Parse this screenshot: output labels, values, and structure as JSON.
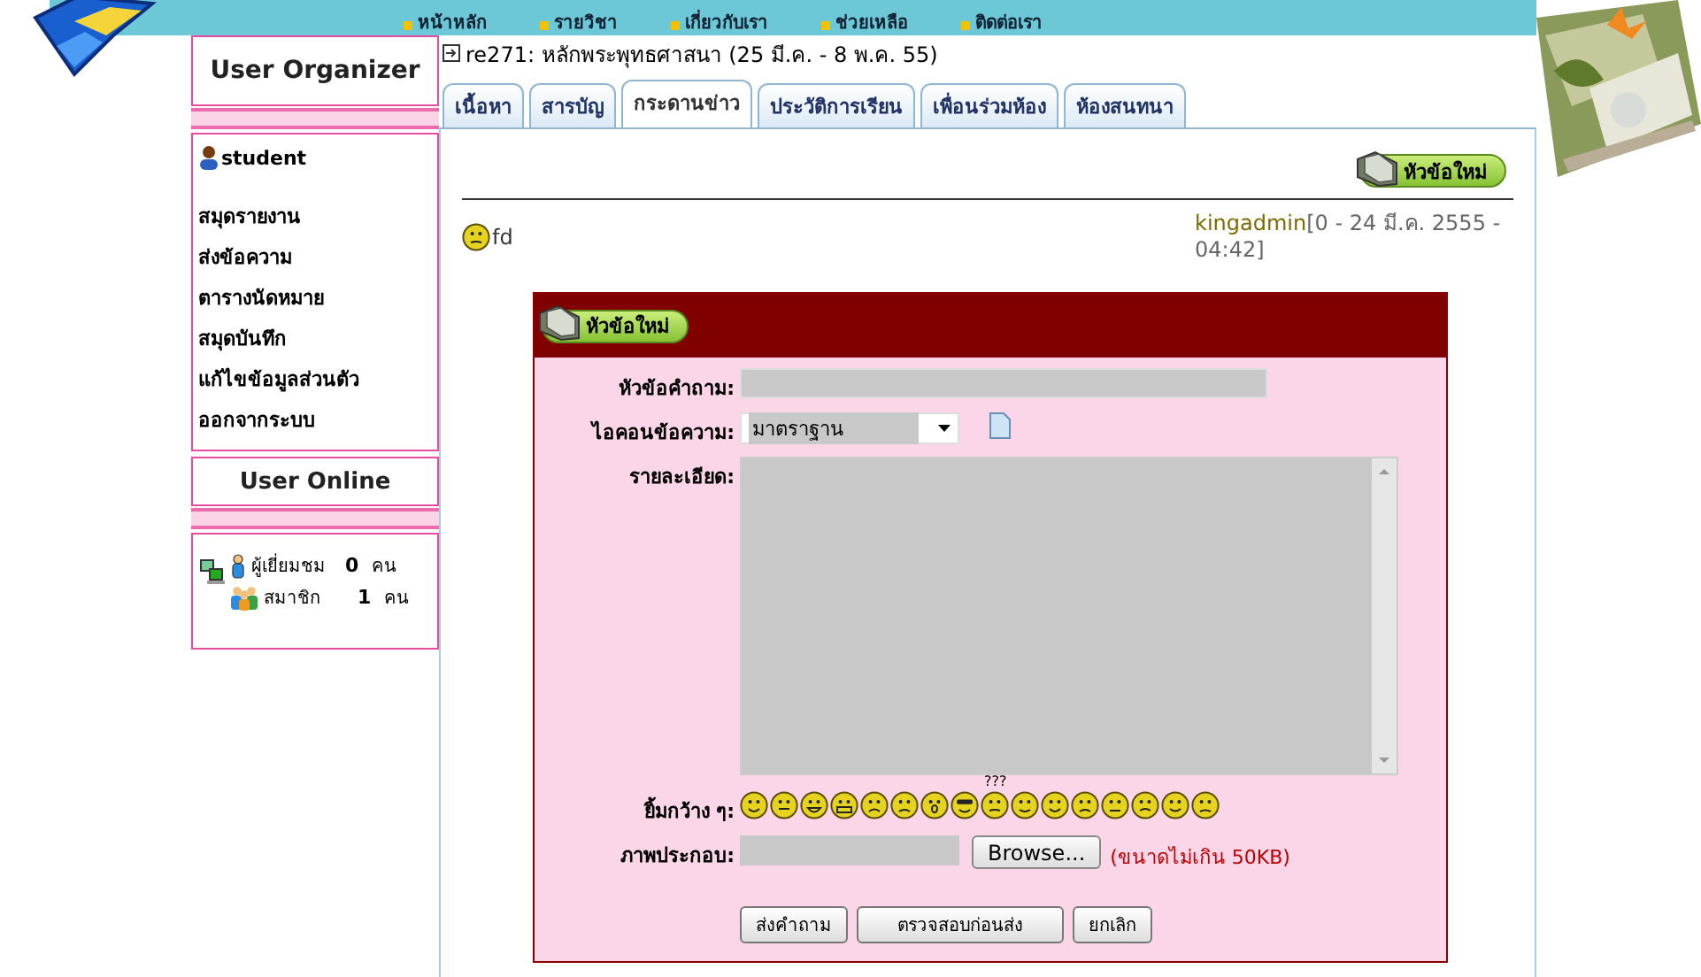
{
  "nav": [
    "หน้าหลัก",
    "รายวิชา",
    "เกี่ยวกับเรา",
    "ช่วยเหลือ",
    "ติดต่อเรา"
  ],
  "course_title": "re271: หลักพระพุทธศาสนา (25 มี.ค. - 8 พ.ค. 55)",
  "tabs": [
    {
      "label": "เนื้อหา",
      "selected": false
    },
    {
      "label": "สารบัญ",
      "selected": false
    },
    {
      "label": "กระดานข่าว",
      "selected": true
    },
    {
      "label": "ประวัติการเรียน",
      "selected": false
    },
    {
      "label": "เพื่อนร่วมห้อง",
      "selected": false
    },
    {
      "label": "ห้องสนทนา",
      "selected": false
    }
  ],
  "sidebar": {
    "organizer_title": "User Organizer",
    "user": "student",
    "menu": [
      "สมุดรายงาน",
      "ส่งข้อความ",
      "ตารางนัดหมาย",
      "สมุดบันทึก",
      "แก้ไขข้อมูลส่วนตัว",
      "ออกจากระบบ"
    ],
    "online_title": "User Online",
    "online": [
      {
        "kind": "guest",
        "label": "ผู้เยี่ยมชม",
        "count": "0",
        "unit": "คน"
      },
      {
        "kind": "member",
        "label": "สมาชิก",
        "count": "1",
        "unit": "คน"
      }
    ]
  },
  "board": {
    "new_topic_button": "หัวข้อใหม่",
    "posts": [
      {
        "title": "fd",
        "author": "kingadmin",
        "meta": "[0 - 24 มี.ค. 2555 - 04:42]"
      }
    ]
  },
  "form": {
    "header_button": "หัวข้อใหม่",
    "fields": [
      {
        "kind": "text",
        "label": "หัวข้อคำถาม:"
      },
      {
        "kind": "select",
        "label": "ไอคอนข้อความ:",
        "value": "มาตราฐาน"
      },
      {
        "kind": "textarea",
        "label": "รายละเอียด:"
      },
      {
        "kind": "smileys",
        "label": "ยิ้มกว้าง ๆ:",
        "caption": "???"
      },
      {
        "kind": "file",
        "label": "ภาพประกอบ:",
        "button": "Browse...",
        "note": "(ขนาดไม่เกิน 50KB)"
      }
    ],
    "buttons": [
      "ส่งคำถาม",
      "ตรวจสอบก่อนส่ง",
      "ยกเลิก"
    ]
  }
}
